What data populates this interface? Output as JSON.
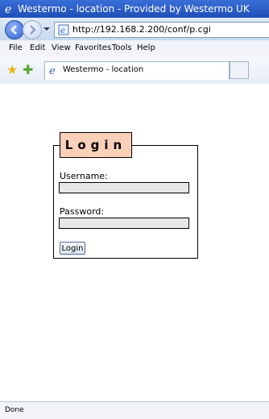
{
  "window": {
    "title": "Westermo - location - Provided by Westermo UK"
  },
  "addressbar": {
    "url": "http://192.168.2.200/conf/p.cgi"
  },
  "menu": {
    "items": [
      "File",
      "Edit",
      "View",
      "Favorites",
      "Tools",
      "Help"
    ]
  },
  "favorites": {
    "tab_title": "Westermo - location"
  },
  "login": {
    "legend": "Login",
    "username_label": "Username:",
    "username_value": "",
    "password_label": "Password:",
    "password_value": "",
    "button_label": "Login"
  },
  "status": {
    "text": "Done"
  },
  "colors": {
    "legend_background": "#fbd0b8",
    "input_background": "#e6e6e6",
    "titlebar": "#2b5fcc"
  },
  "icons": [
    "ie-logo-icon",
    "back-arrow-icon",
    "forward-arrow-icon",
    "dropdown-arrow-icon",
    "page-icon",
    "favorites-star-icon",
    "add-favorites-icon",
    "tab-page-icon"
  ]
}
